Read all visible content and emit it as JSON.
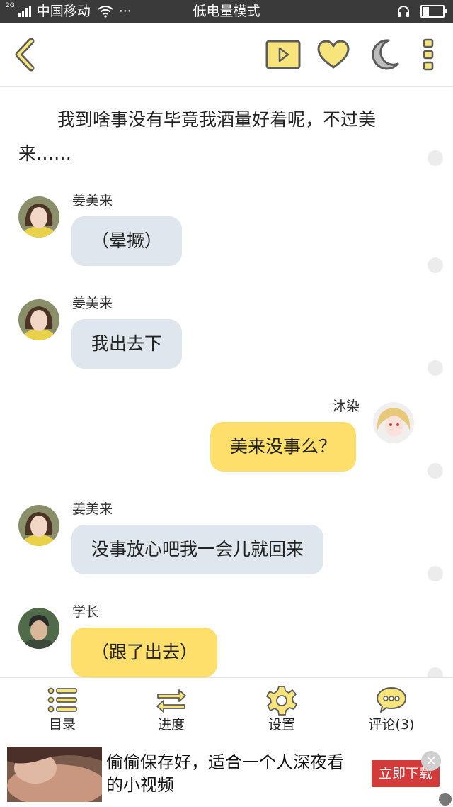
{
  "status_bar": {
    "network": "2G",
    "carrier": "中国移动",
    "more": "···",
    "mode": "低电量模式",
    "battery_level": 0.3
  },
  "toolbar": {
    "back_icon": "chevron-left-icon",
    "play_icon": "play-icon",
    "favorite_icon": "heart-icon",
    "night_icon": "moon-icon",
    "more_icon": "vertical-dots-icon",
    "accent_color": "#f7e47a",
    "outline_color": "#5b5b5b"
  },
  "chat": {
    "narration": "我到啥事没有毕竟我酒量好着呢，不过美来……",
    "messages": [
      {
        "side": "left",
        "name": "姜美来",
        "text": "（晕撅）",
        "style": "grey"
      },
      {
        "side": "left",
        "name": "姜美来",
        "text": "我出去下",
        "style": "grey"
      },
      {
        "side": "right",
        "name": "沐染",
        "text": "美来没事么？",
        "style": "yellow"
      },
      {
        "side": "left",
        "name": "姜美来",
        "text": "没事放心吧我一会儿就回来",
        "style": "grey"
      },
      {
        "side": "left",
        "name": "学长",
        "text": "（跟了出去）",
        "style": "yellow"
      }
    ]
  },
  "bottom_nav": {
    "items": [
      {
        "label": "目录",
        "icon": "list-icon"
      },
      {
        "label": "进度",
        "icon": "arrows-swap-icon"
      },
      {
        "label": "设置",
        "icon": "gear-icon"
      },
      {
        "label": "评论(3)",
        "icon": "comment-icon"
      }
    ]
  },
  "ad": {
    "text": "偷偷保存好，适合一个人深夜看的小视频",
    "cta": "立即下载",
    "close": "×"
  }
}
